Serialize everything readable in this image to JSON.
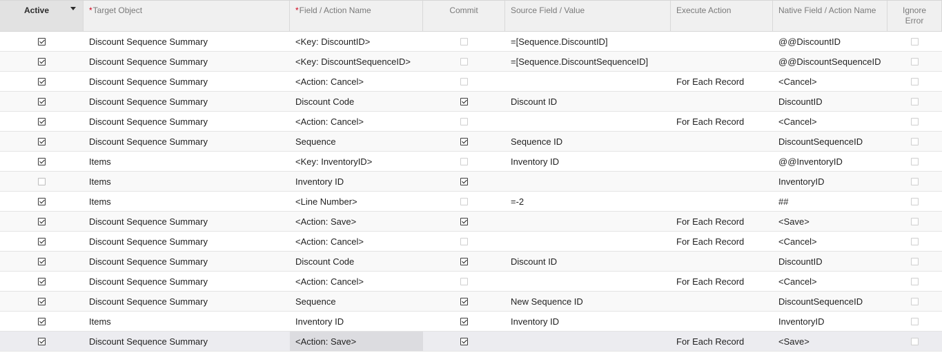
{
  "columns": {
    "active": "Active",
    "target": "Target Object",
    "field": "Field / Action Name",
    "commit": "Commit",
    "source": "Source Field / Value",
    "exec": "Execute Action",
    "native": "Native Field / Action Name",
    "ignore": "Ignore Error",
    "required_mark": "*"
  },
  "rows": [
    {
      "active": true,
      "target": "Discount Sequence Summary",
      "field": "<Key: DiscountID>",
      "commit": false,
      "source": "=[Sequence.DiscountID]",
      "exec": "",
      "native": "@@DiscountID",
      "ignore": false
    },
    {
      "active": true,
      "target": "Discount Sequence Summary",
      "field": "<Key: DiscountSequenceID>",
      "commit": false,
      "source": "=[Sequence.DiscountSequenceID]",
      "exec": "",
      "native": "@@DiscountSequenceID",
      "ignore": false
    },
    {
      "active": true,
      "target": "Discount Sequence Summary",
      "field": "<Action: Cancel>",
      "commit": false,
      "source": "",
      "exec": "For Each Record",
      "native": "<Cancel>",
      "ignore": false
    },
    {
      "active": true,
      "target": "Discount Sequence Summary",
      "field": "Discount Code",
      "commit": true,
      "source": "Discount ID",
      "exec": "",
      "native": "DiscountID",
      "ignore": false
    },
    {
      "active": true,
      "target": "Discount Sequence Summary",
      "field": "<Action: Cancel>",
      "commit": false,
      "source": "",
      "exec": "For Each Record",
      "native": "<Cancel>",
      "ignore": false
    },
    {
      "active": true,
      "target": "Discount Sequence Summary",
      "field": "Sequence",
      "commit": true,
      "source": "Sequence ID",
      "exec": "",
      "native": "DiscountSequenceID",
      "ignore": false
    },
    {
      "active": true,
      "target": "Items",
      "field": "<Key: InventoryID>",
      "commit": false,
      "source": "Inventory ID",
      "exec": "",
      "native": "@@InventoryID",
      "ignore": false
    },
    {
      "active": false,
      "target": "Items",
      "field": "Inventory ID",
      "commit": true,
      "source": "",
      "exec": "",
      "native": "InventoryID",
      "ignore": false
    },
    {
      "active": true,
      "target": "Items",
      "field": "<Line Number>",
      "commit": false,
      "source": "=-2",
      "exec": "",
      "native": "##",
      "ignore": false
    },
    {
      "active": true,
      "target": "Discount Sequence Summary",
      "field": "<Action: Save>",
      "commit": true,
      "source": "",
      "exec": "For Each Record",
      "native": "<Save>",
      "ignore": false
    },
    {
      "active": true,
      "target": "Discount Sequence Summary",
      "field": "<Action: Cancel>",
      "commit": false,
      "source": "",
      "exec": "For Each Record",
      "native": "<Cancel>",
      "ignore": false
    },
    {
      "active": true,
      "target": "Discount Sequence Summary",
      "field": "Discount Code",
      "commit": true,
      "source": "Discount ID",
      "exec": "",
      "native": "DiscountID",
      "ignore": false
    },
    {
      "active": true,
      "target": "Discount Sequence Summary",
      "field": "<Action: Cancel>",
      "commit": false,
      "source": "",
      "exec": "For Each Record",
      "native": "<Cancel>",
      "ignore": false
    },
    {
      "active": true,
      "target": "Discount Sequence Summary",
      "field": "Sequence",
      "commit": true,
      "source": "New Sequence ID",
      "exec": "",
      "native": "DiscountSequenceID",
      "ignore": false
    },
    {
      "active": true,
      "target": "Items",
      "field": "Inventory ID",
      "commit": true,
      "source": "Inventory ID",
      "exec": "",
      "native": "InventoryID",
      "ignore": false
    },
    {
      "active": true,
      "target": "Discount Sequence Summary",
      "field": "<Action: Save>",
      "commit": true,
      "source": "",
      "exec": "For Each Record",
      "native": "<Save>",
      "ignore": false
    }
  ],
  "selected_row": 15,
  "colors": {
    "header_bg": "#f0f0f0",
    "active_header_bg": "#e2e2e2",
    "required": "#d0021b",
    "selected_row_bg": "#ececf0"
  }
}
